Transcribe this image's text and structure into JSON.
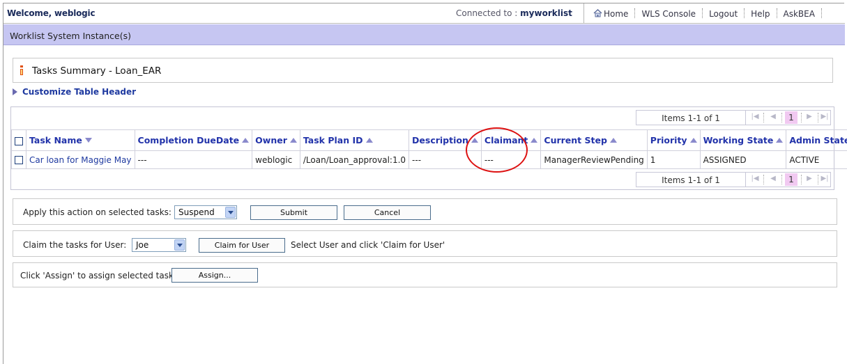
{
  "header": {
    "welcome": "Welcome, weblogic",
    "connected_label": "Connected to : ",
    "connected_value": "myworklist",
    "links": [
      "Home",
      "WLS Console",
      "Logout",
      "Help",
      "AskBEA"
    ]
  },
  "banner": {
    "title": "Worklist System Instance(s)"
  },
  "summary": {
    "title": "Tasks Summary - Loan_EAR"
  },
  "customize_link": "Customize Table Header",
  "pager": {
    "items_text": "Items 1-1 of 1",
    "current_page": "1"
  },
  "table": {
    "columns": [
      "Task Name",
      "Completion DueDate",
      "Owner",
      "Task Plan ID",
      "Description",
      "Claimant",
      "Current Step",
      "Priority",
      "Working State",
      "Admin State"
    ],
    "rows": [
      {
        "task_name": "Car loan for Maggie May",
        "completion_due": "---",
        "owner": "weblogic",
        "task_plan_id": "/Loan/Loan_approval:1.0",
        "description": "---",
        "claimant": "---",
        "current_step": "ManagerReviewPending",
        "priority": "1",
        "working_state": "ASSIGNED",
        "admin_state": "ACTIVE"
      }
    ]
  },
  "actions": {
    "apply_label": "Apply this action on selected tasks:",
    "apply_select_value": "Suspend",
    "submit_label": "Submit",
    "cancel_label": "Cancel",
    "claim_label": "Claim the tasks for User:",
    "claim_select_value": "Joe",
    "claim_button_label": "Claim for User",
    "claim_hint": "Select User and click 'Claim for User'",
    "assign_label": "Click 'Assign' to assign selected tasks",
    "assign_button_label": "Assign..."
  },
  "annotation": {
    "highlight_color": "#dd1111"
  },
  "colors": {
    "banner": "#c6c6f2",
    "link": "#1f3aa0",
    "pager_current": "#f1c9f1"
  }
}
